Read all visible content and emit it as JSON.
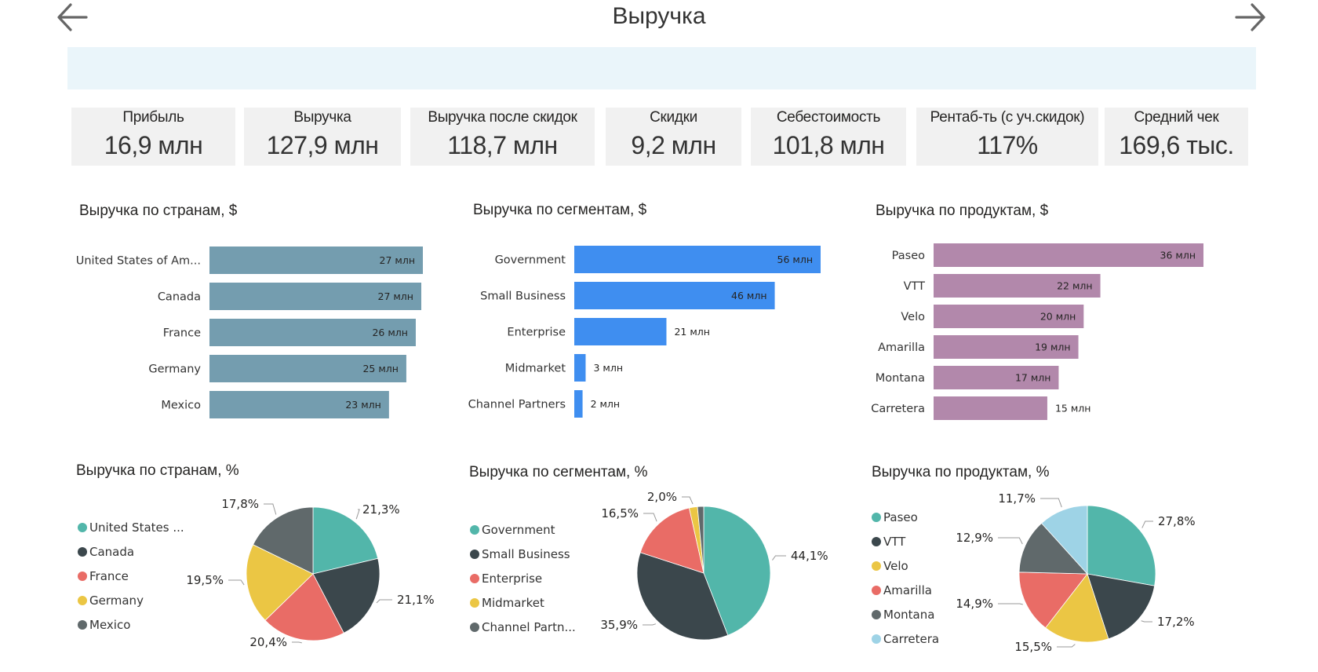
{
  "page": {
    "title": "Выручка",
    "back_icon": "arrow-left-icon",
    "forward_icon": "arrow-right-icon"
  },
  "kpis": [
    {
      "label": "Прибыль",
      "value": "16,9 млн"
    },
    {
      "label": "Выручка",
      "value": "127,9 млн"
    },
    {
      "label": "Выручка после скидок",
      "value": "118,7 млн"
    },
    {
      "label": "Скидки",
      "value": "9,2 млн"
    },
    {
      "label": "Себестоимость",
      "value": "101,8 млн"
    },
    {
      "label": "Рентаб-ть (с уч.скидок)",
      "value": "117%"
    },
    {
      "label": "Средний чек",
      "value": "169,6 тыс."
    }
  ],
  "colors": {
    "country_bar": "#749daf",
    "segment_bar": "#3f8ef0",
    "product_bar": "#b288ab",
    "pie": [
      "#52b6aa",
      "#3b474c",
      "#e96c66",
      "#ebc644",
      "#60696b",
      "#9ed3e6"
    ]
  },
  "chart_data": [
    {
      "id": "bar_countries",
      "type": "bar",
      "orientation": "horizontal",
      "title": "Выручка по странам, $",
      "categories": [
        "United States of Am...",
        "Canada",
        "France",
        "Germany",
        "Mexico"
      ],
      "values": [
        27.1,
        26.9,
        26.2,
        25.0,
        22.8
      ],
      "labels": [
        "27 млн",
        "27 млн",
        "26 млн",
        "25 млн",
        "23 млн"
      ],
      "unit": "млн"
    },
    {
      "id": "bar_segments",
      "type": "bar",
      "orientation": "horizontal",
      "title": "Выручка по сегментам, $",
      "categories": [
        "Government",
        "Small Business",
        "Enterprise",
        "Midmarket",
        "Channel Partners"
      ],
      "values": [
        56.4,
        45.9,
        21.1,
        2.6,
        1.9
      ],
      "labels": [
        "56 млн",
        "46 млн",
        "21 млн",
        "3 млн",
        "2 млн"
      ],
      "unit": "млн"
    },
    {
      "id": "bar_products",
      "type": "bar",
      "orientation": "horizontal",
      "title": "Выручка по продуктам, $",
      "categories": [
        "Paseo",
        "VTT",
        "Velo",
        "Amarilla",
        "Montana",
        "Carretera"
      ],
      "values": [
        35.6,
        22.0,
        19.8,
        19.1,
        16.5,
        15.0
      ],
      "labels": [
        "36 млн",
        "22 млн",
        "20 млн",
        "19 млн",
        "17 млн",
        "15 млн"
      ],
      "unit": "млн"
    },
    {
      "id": "pie_countries",
      "type": "pie",
      "title": "Выручка по странам, %",
      "categories": [
        "United States ...",
        "Canada",
        "France",
        "Germany",
        "Mexico"
      ],
      "values": [
        21.3,
        21.1,
        20.4,
        19.5,
        17.8
      ],
      "labels": [
        "21,3%",
        "21,1%",
        "20,4%",
        "19,5%",
        "17,8%"
      ],
      "legend": "left"
    },
    {
      "id": "pie_segments",
      "type": "pie",
      "title": "Выручка по сегментам, %",
      "categories": [
        "Government",
        "Small Business",
        "Enterprise",
        "Midmarket",
        "Channel Partn..."
      ],
      "values": [
        44.1,
        35.9,
        16.5,
        2.0,
        1.5
      ],
      "labels": [
        "44,1%",
        "35,9%",
        "16,5%",
        "2,0%",
        ""
      ],
      "legend": "left"
    },
    {
      "id": "pie_products",
      "type": "pie",
      "title": "Выручка по продуктам, %",
      "categories": [
        "Paseo",
        "VTT",
        "Velo",
        "Amarilla",
        "Montana",
        "Carretera"
      ],
      "values": [
        27.8,
        17.2,
        15.5,
        14.9,
        12.9,
        11.7
      ],
      "labels": [
        "27,8%",
        "17,2%",
        "15,5%",
        "14,9%",
        "12,9%",
        "11,7%"
      ],
      "legend": "left"
    }
  ]
}
